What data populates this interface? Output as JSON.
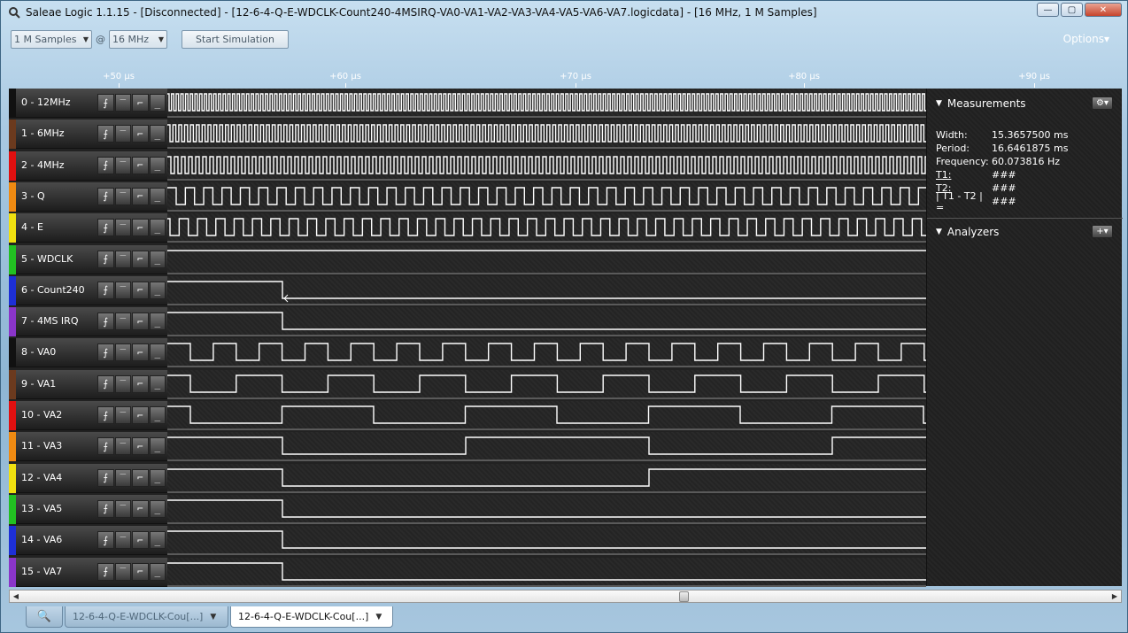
{
  "window": {
    "title": "Saleae Logic 1.1.15 - [Disconnected] - [12-6-4-Q-E-WDCLK-Count240-4MSIRQ-VA0-VA1-VA2-VA3-VA4-VA5-VA6-VA7.logicdata] - [16 MHz, 1 M Samples]",
    "minimize": "—",
    "maximize": "▢",
    "close": "✕"
  },
  "toolbar": {
    "samples": "1 M Samples",
    "at": "@",
    "rate": "16 MHz",
    "start_simulation": "Start Simulation",
    "options": "Options▾"
  },
  "ruler": {
    "ticks": [
      "+50 µs",
      "+60 µs",
      "+70 µs",
      "+80 µs",
      "+90 µs"
    ]
  },
  "trigger_glyphs": [
    "⨍",
    "‾",
    "⌐",
    "_"
  ],
  "channels": [
    {
      "name": "0 - 12MHz",
      "color": "#111111"
    },
    {
      "name": "1 - 6MHz",
      "color": "#6b3a1e"
    },
    {
      "name": "2 - 4MHz",
      "color": "#e01010"
    },
    {
      "name": "3 - Q",
      "color": "#ef8a12"
    },
    {
      "name": "4 - E",
      "color": "#f0e010"
    },
    {
      "name": "5 - WDCLK",
      "color": "#22c022"
    },
    {
      "name": "6 - Count240",
      "color": "#1d2fd6"
    },
    {
      "name": "7 - 4MS IRQ",
      "color": "#8a35c9"
    },
    {
      "name": "8 - VA0",
      "color": "#111111"
    },
    {
      "name": "9 - VA1",
      "color": "#6b3a1e"
    },
    {
      "name": "10 - VA2",
      "color": "#e01010"
    },
    {
      "name": "11 - VA3",
      "color": "#ef8a12"
    },
    {
      "name": "12 - VA4",
      "color": "#f0e010"
    },
    {
      "name": "13 - VA5",
      "color": "#22c022"
    },
    {
      "name": "14 - VA6",
      "color": "#1d2fd6"
    },
    {
      "name": "15 - VA7",
      "color": "#8a35c9"
    }
  ],
  "measurements": {
    "title": "Measurements",
    "rows": [
      {
        "key": "Width:",
        "value": "15.3657500 ms"
      },
      {
        "key": "Period:",
        "value": "16.6461875 ms"
      },
      {
        "key": "Frequency:",
        "value": "60.073816 Hz"
      },
      {
        "key": "T1:",
        "value": "###"
      },
      {
        "key": "T2:",
        "value": "###"
      },
      {
        "key": "| T1 - T2 | =",
        "value": "###"
      }
    ]
  },
  "analyzers": {
    "title": "Analyzers"
  },
  "tabs": [
    {
      "label": "12-6-4-Q-E-WDCLK-Cou[...]"
    },
    {
      "label": "12-6-4-Q-E-WDCLK-Cou[...]"
    }
  ]
}
